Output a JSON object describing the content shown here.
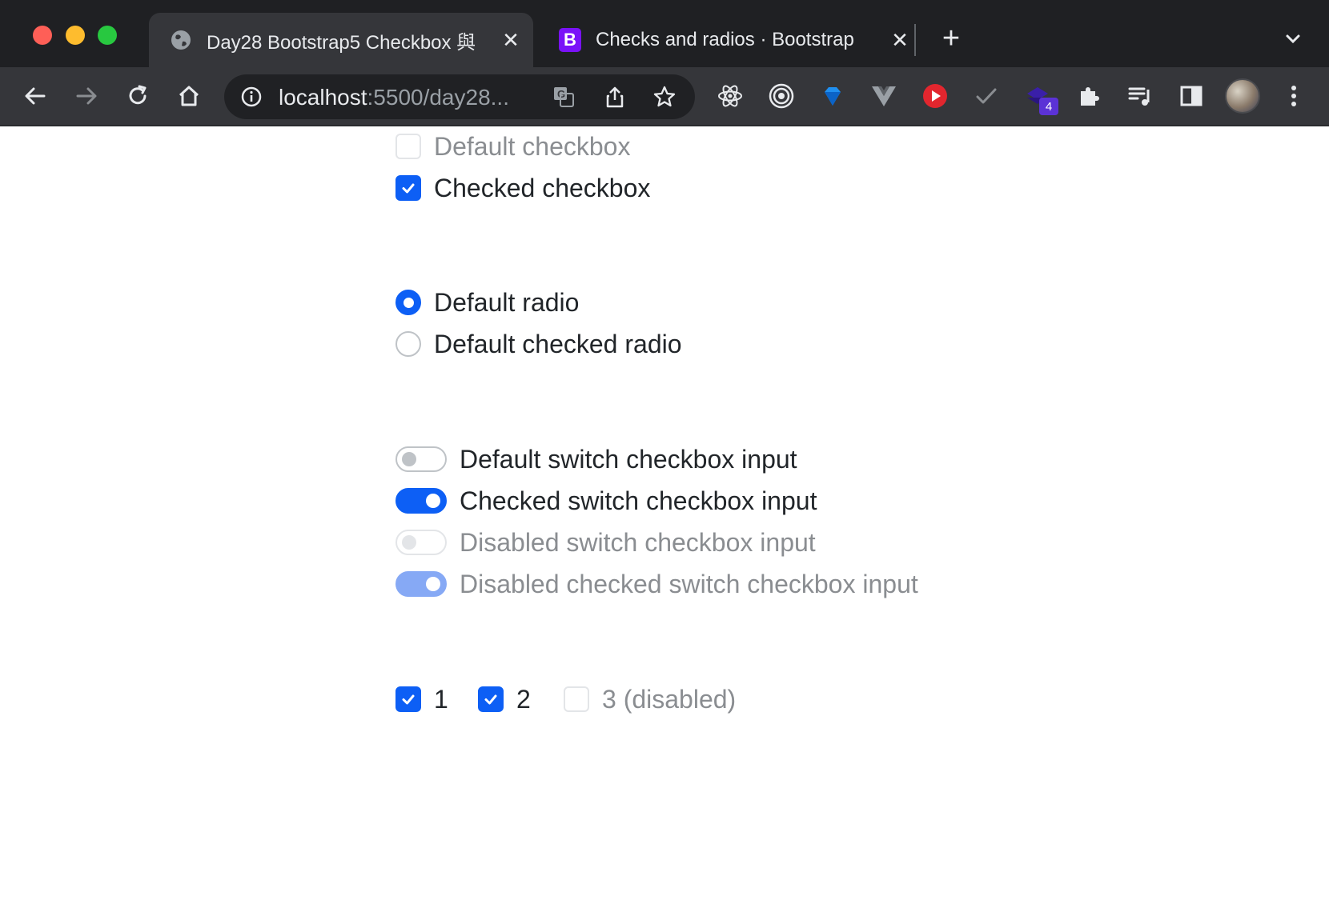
{
  "browser": {
    "tabs": [
      {
        "title": "Day28 Bootstrap5 Checkbox 與",
        "active": true
      },
      {
        "title": "Checks and radios · Bootstrap",
        "active": false,
        "favicon_letter": "B"
      }
    ],
    "address": {
      "host": "localhost",
      "rest": ":5500/day28..."
    },
    "extension_badge": "4",
    "colors": {
      "accent": "#0d5ff5",
      "bootstrap": "#7a12f8",
      "toolbar": "#35363a",
      "tabstrip": "#1f2023"
    }
  },
  "checkboxes": [
    {
      "label": "Default checkbox",
      "checked": false,
      "disabled": true
    },
    {
      "label": "Checked checkbox",
      "checked": true,
      "disabled": false
    }
  ],
  "radios": [
    {
      "label": "Default radio",
      "checked": true
    },
    {
      "label": "Default checked radio",
      "checked": false
    }
  ],
  "switches": [
    {
      "label": "Default switch checkbox input",
      "checked": false,
      "disabled": false
    },
    {
      "label": "Checked switch checkbox input",
      "checked": true,
      "disabled": false
    },
    {
      "label": "Disabled switch checkbox input",
      "checked": false,
      "disabled": true
    },
    {
      "label": "Disabled checked switch checkbox input",
      "checked": true,
      "disabled": true
    }
  ],
  "inline_checkboxes": [
    {
      "label": "1",
      "checked": true,
      "disabled": false
    },
    {
      "label": "2",
      "checked": true,
      "disabled": false
    },
    {
      "label": "3 (disabled)",
      "checked": false,
      "disabled": true
    }
  ]
}
